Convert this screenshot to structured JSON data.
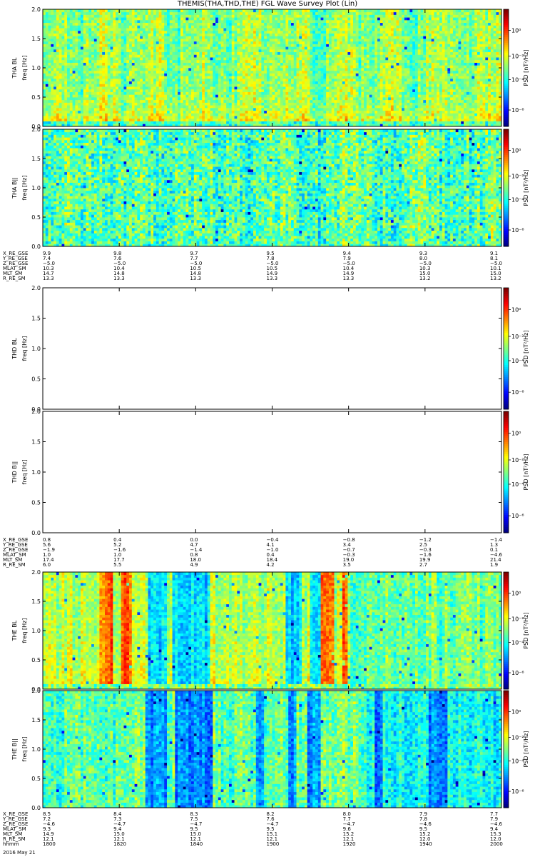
{
  "title": "THEMIS(THA,THD,THE) FGL Wave Survey Plot (Lin)",
  "colors": {
    "frame": "#000000",
    "separator": "#ffffff",
    "empty_panel": "#ffffff"
  },
  "colorbar": {
    "label": "PSD [nT²/Hz]",
    "scale": "log",
    "range": [
      1e-10,
      100.0
    ],
    "ticks": [
      "10⁰",
      "10⁻²",
      "10⁻⁴",
      "10⁻⁶"
    ]
  },
  "spectrogram_panels": [
    {
      "id": "tha-bl",
      "probe": "THA",
      "ylabel": "THA BL",
      "yunit": "freq [Hz]",
      "has_data": true,
      "seed": 11,
      "profile": "tha_perp"
    },
    {
      "id": "tha-bpar",
      "probe": "THA",
      "ylabel": "THA B||",
      "yunit": "freq [Hz]",
      "has_data": true,
      "seed": 23,
      "profile": "tha_par"
    },
    {
      "id": "thd-bl",
      "probe": "THD",
      "ylabel": "THD BL",
      "yunit": "freq [Hz]",
      "has_data": false,
      "seed": 0,
      "profile": "none"
    },
    {
      "id": "thd-bpar",
      "probe": "THD",
      "ylabel": "THD B||",
      "yunit": "freq [Hz]",
      "has_data": false,
      "seed": 0,
      "profile": "none"
    },
    {
      "id": "the-bl",
      "probe": "THE",
      "ylabel": "THE BL",
      "yunit": "freq [Hz]",
      "has_data": true,
      "seed": 37,
      "profile": "the_perp"
    },
    {
      "id": "the-bpar",
      "probe": "THE",
      "ylabel": "THE B||",
      "yunit": "freq [Hz]",
      "has_data": true,
      "seed": 53,
      "profile": "the_par"
    }
  ],
  "chart_data": {
    "type": "heatmap",
    "title": "THEMIS(THA,THD,THE) FGL Wave Survey Plot (Lin)",
    "x": {
      "label": "hhmm",
      "ticks": [
        "1800",
        "1820",
        "1840",
        "1900",
        "1920",
        "1940",
        "2000"
      ],
      "range": [
        "1800",
        "2000"
      ]
    },
    "y": {
      "label": "freq [Hz]",
      "range": [
        0,
        2.0
      ],
      "ticks": [
        "0.0",
        "0.5",
        "1.0",
        "1.5",
        "2.0"
      ]
    },
    "z": {
      "label": "PSD [nT²/Hz]",
      "scale": "log",
      "ticks": [
        "10⁰",
        "10⁻²",
        "10⁻⁴",
        "10⁻⁶"
      ]
    },
    "date": "2016 May 21"
  },
  "ephemeris": [
    {
      "probe": "THA",
      "rows": [
        {
          "name": "X_RE_GSE",
          "values": [
            "9.9",
            "9.8",
            "9.7",
            "9.5",
            "9.4",
            "9.3",
            "9.1"
          ]
        },
        {
          "name": "Y_RE_GSE",
          "values": [
            "7.4",
            "7.6",
            "7.7",
            "7.8",
            "7.9",
            "8.0",
            "8.1"
          ]
        },
        {
          "name": "Z_RE_GSE",
          "values": [
            "−5.0",
            "−5.0",
            "−5.0",
            "−5.0",
            "−5.0",
            "−5.0",
            "−5.0"
          ]
        },
        {
          "name": "MLAT_SM",
          "values": [
            "10.3",
            "10.4",
            "10.5",
            "10.5",
            "10.4",
            "10.3",
            "10.1"
          ]
        },
        {
          "name": "MLT_SM",
          "values": [
            "14.7",
            "14.8",
            "14.8",
            "14.9",
            "14.9",
            "15.0",
            "15.0"
          ]
        },
        {
          "name": "R_RE_SM",
          "values": [
            "13.3",
            "13.3",
            "13.3",
            "13.3",
            "13.3",
            "13.2",
            "13.2"
          ]
        }
      ]
    },
    {
      "probe": "THD",
      "rows": [
        {
          "name": "X_RE_GSE",
          "values": [
            "0.8",
            "0.4",
            "0.0",
            "−0.4",
            "−0.8",
            "−1.2",
            "−1.4"
          ]
        },
        {
          "name": "Y_RE_GSE",
          "values": [
            "5.6",
            "5.2",
            "4.7",
            "4.1",
            "3.4",
            "2.5",
            "1.3"
          ]
        },
        {
          "name": "Z_RE_GSE",
          "values": [
            "−1.9",
            "−1.6",
            "−1.4",
            "−1.0",
            "−0.7",
            "−0.3",
            "0.1"
          ]
        },
        {
          "name": "MLAT_SM",
          "values": [
            "1.0",
            "1.0",
            "0.8",
            "0.4",
            "−0.3",
            "−1.6",
            "−4.6"
          ]
        },
        {
          "name": "MLT_SM",
          "values": [
            "17.4",
            "17.7",
            "18.0",
            "18.4",
            "19.0",
            "19.9",
            "21.4"
          ]
        },
        {
          "name": "R_RE_SM",
          "values": [
            "6.0",
            "5.5",
            "4.9",
            "4.2",
            "3.5",
            "2.7",
            "1.9"
          ]
        }
      ]
    },
    {
      "probe": "THE",
      "rows": [
        {
          "name": "X_RE_GSE",
          "values": [
            "8.5",
            "8.4",
            "8.3",
            "8.2",
            "8.0",
            "7.9",
            "7.7"
          ]
        },
        {
          "name": "Y_RE_GSE",
          "values": [
            "7.2",
            "7.3",
            "7.5",
            "7.6",
            "7.7",
            "7.8",
            "7.9"
          ]
        },
        {
          "name": "Z_RE_GSE",
          "values": [
            "−4.6",
            "−4.7",
            "−4.7",
            "−4.7",
            "−4.7",
            "−4.6",
            "−4.6"
          ]
        },
        {
          "name": "MLAT_SM",
          "values": [
            "9.3",
            "9.4",
            "9.5",
            "9.5",
            "9.6",
            "9.5",
            "9.4"
          ]
        },
        {
          "name": "MLT_SM",
          "values": [
            "14.9",
            "15.0",
            "15.0",
            "15.1",
            "15.2",
            "15.2",
            "15.3"
          ]
        },
        {
          "name": "R_RE_SM",
          "values": [
            "12.1",
            "12.1",
            "12.1",
            "12.1",
            "12.1",
            "12.0",
            "12.0"
          ]
        },
        {
          "name": "hhmm",
          "values": [
            "1800",
            "1820",
            "1840",
            "1900",
            "1920",
            "1940",
            "2000"
          ]
        }
      ]
    }
  ],
  "footer_date": "2016 May 21"
}
